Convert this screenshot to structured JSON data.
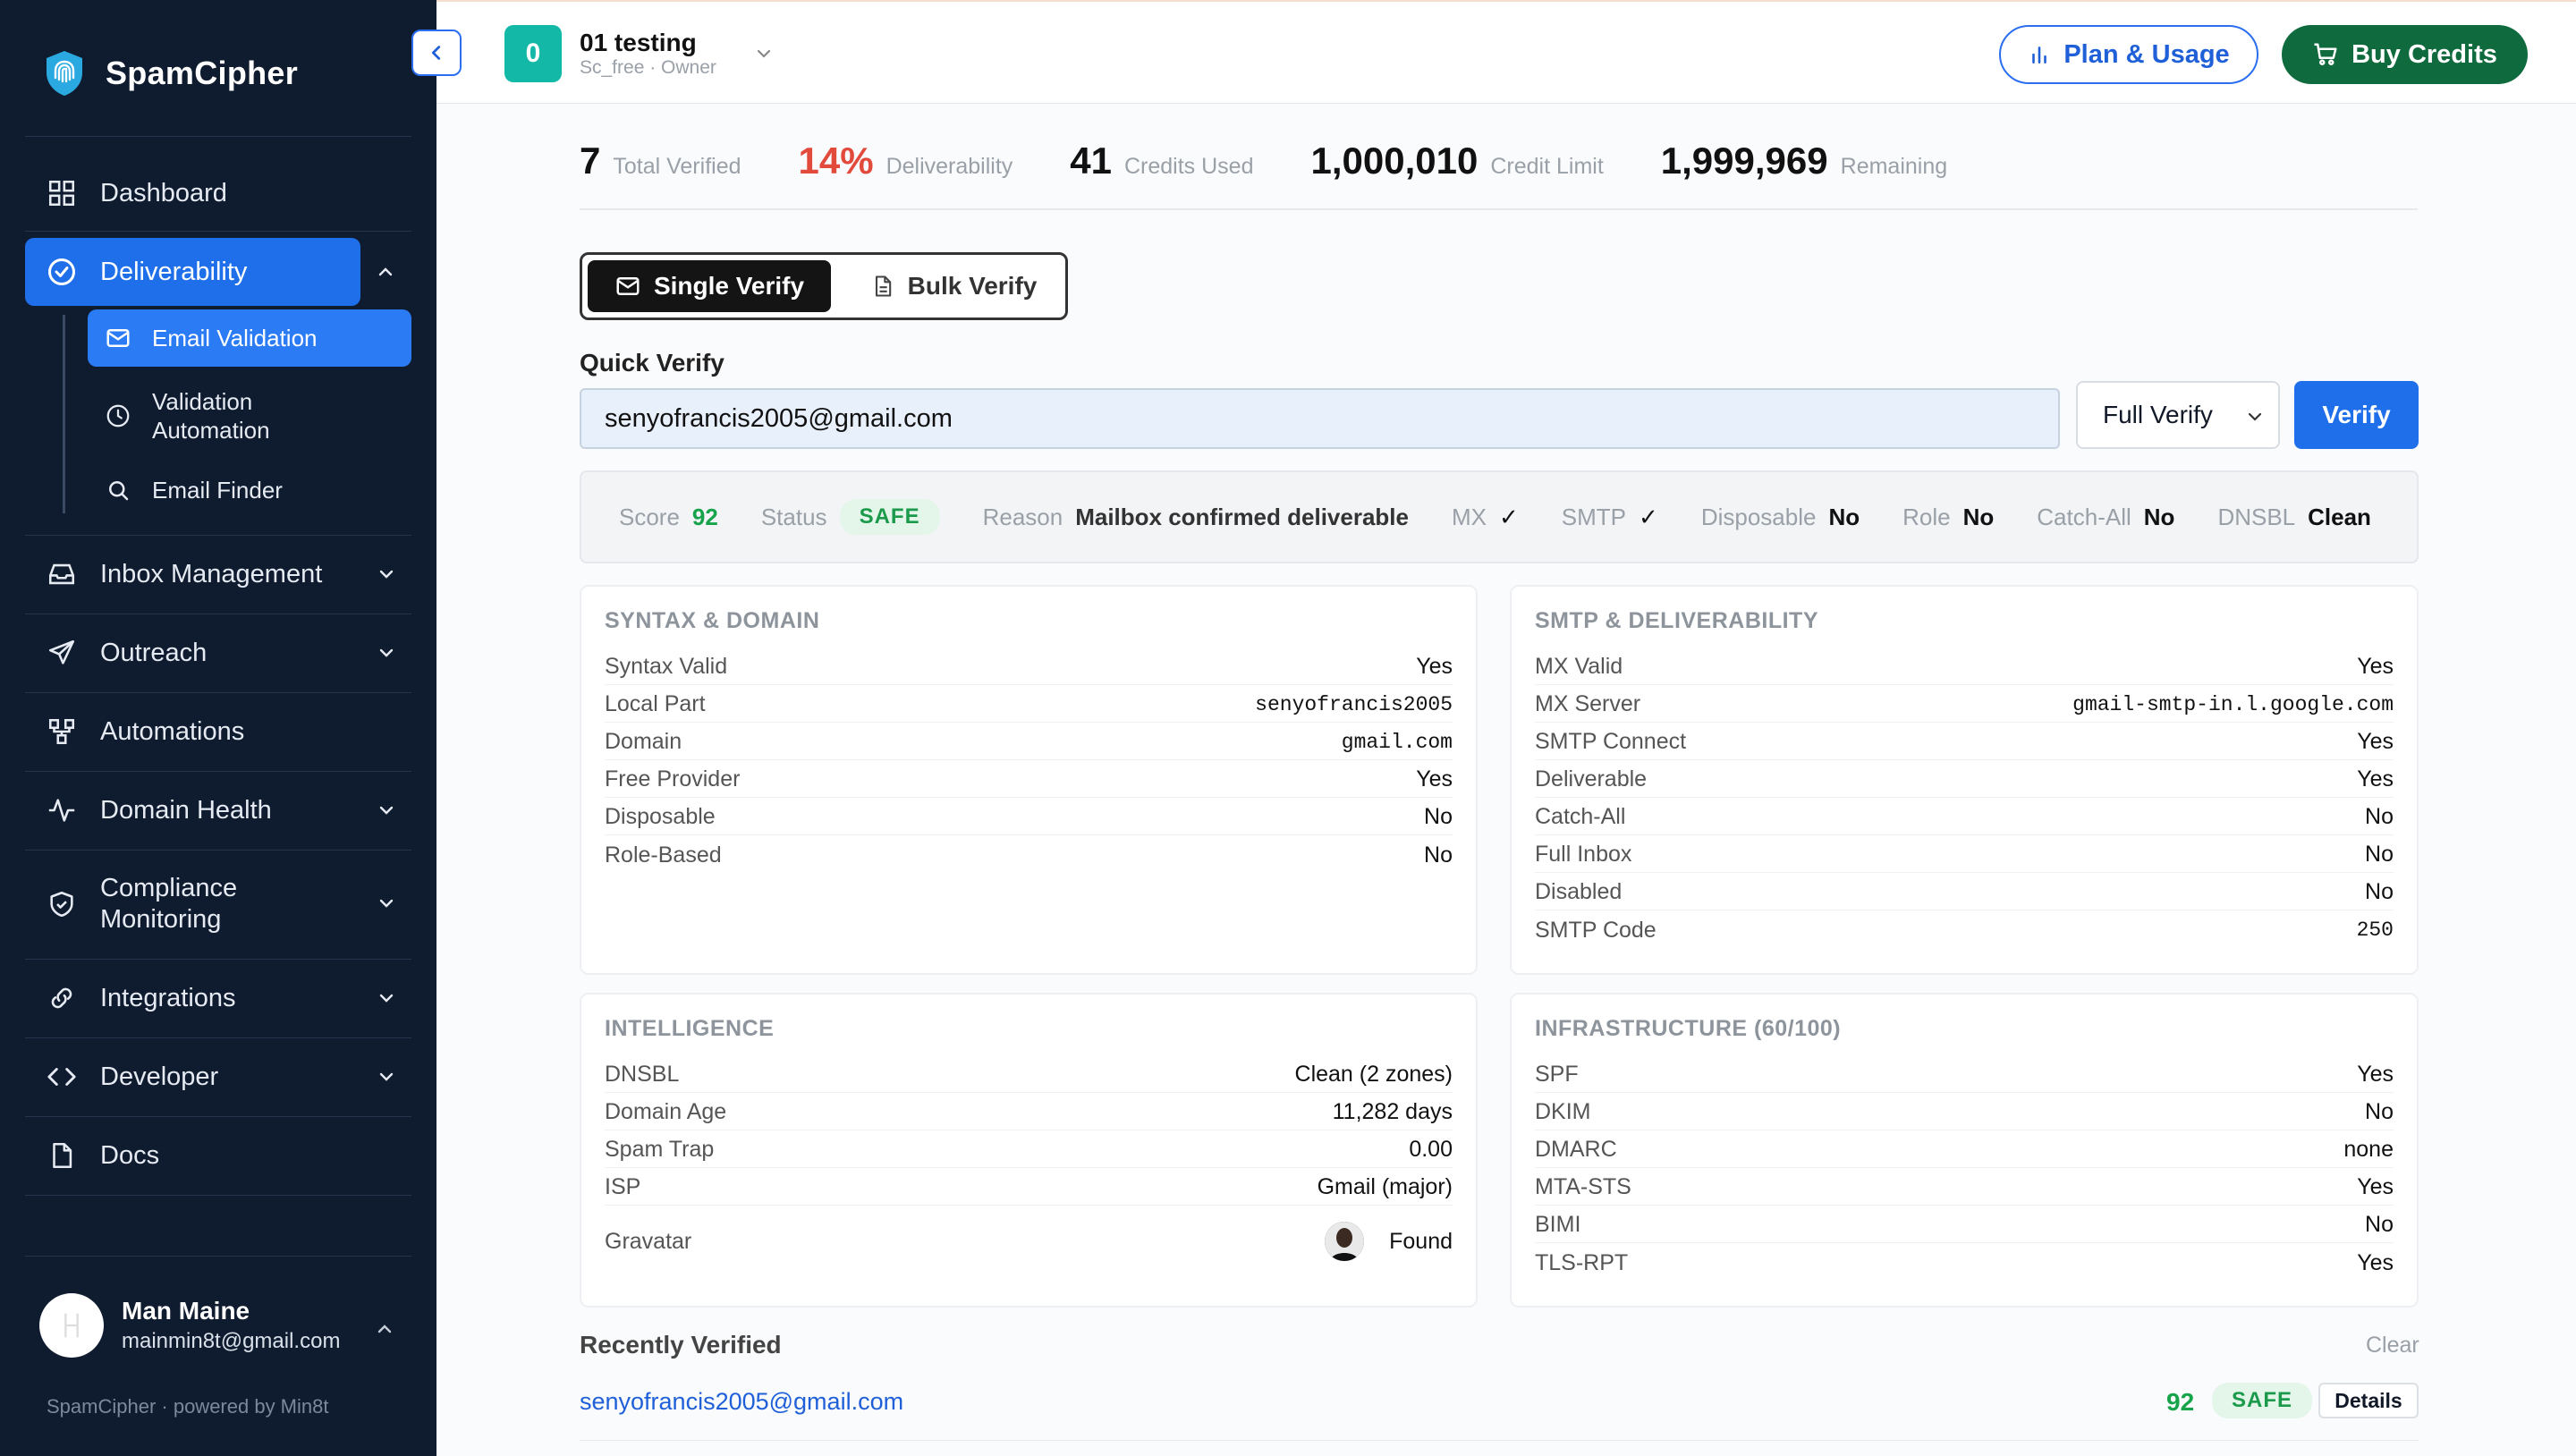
{
  "brand": {
    "name": "SpamCipher"
  },
  "sidebar": {
    "items": [
      {
        "label": "Dashboard"
      },
      {
        "label": "Deliverability"
      },
      {
        "label": "Inbox Management"
      },
      {
        "label": "Outreach"
      },
      {
        "label": "Automations"
      },
      {
        "label": "Domain Health"
      },
      {
        "label": "Compliance Monitoring"
      },
      {
        "label": "Integrations"
      },
      {
        "label": "Developer"
      },
      {
        "label": "Docs"
      }
    ],
    "sub_items": [
      {
        "label": "Email Validation"
      },
      {
        "label": "Validation Automation"
      },
      {
        "label": "Email Finder"
      }
    ],
    "user": {
      "name": "Man Maine",
      "email": "mainmin8t@gmail.com"
    },
    "footer": "SpamCipher · powered by Min8t"
  },
  "workspace": {
    "badge": "0",
    "name": "01 testing",
    "sub": "Sc_free · Owner"
  },
  "topbar": {
    "plan_label": "Plan & Usage",
    "buy_label": "Buy Credits"
  },
  "stats": [
    {
      "value": "7",
      "label": "Total Verified"
    },
    {
      "value": "14%",
      "label": "Deliverability"
    },
    {
      "value": "41",
      "label": "Credits Used"
    },
    {
      "value": "1,000,010",
      "label": "Credit Limit"
    },
    {
      "value": "1,999,969",
      "label": "Remaining"
    }
  ],
  "tabs": {
    "single": "Single Verify",
    "bulk": "Bulk Verify"
  },
  "quick_verify": {
    "label": "Quick Verify",
    "email": "senyofrancis2005@gmail.com",
    "mode": "Full Verify",
    "button": "Verify"
  },
  "result": {
    "score_label": "Score",
    "score": "92",
    "status_label": "Status",
    "status": "SAFE",
    "reason_label": "Reason",
    "reason": "Mailbox confirmed deliverable",
    "mx_label": "MX",
    "mx": "✓",
    "smtp_label": "SMTP",
    "smtp": "✓",
    "disposable_label": "Disposable",
    "disposable": "No",
    "role_label": "Role",
    "role": "No",
    "catchall_label": "Catch-All",
    "catchall": "No",
    "dnsbl_label": "DNSBL",
    "dnsbl": "Clean"
  },
  "cards": {
    "syntax": {
      "title": "SYNTAX & DOMAIN",
      "rows": [
        {
          "k": "Syntax Valid",
          "v": "Yes"
        },
        {
          "k": "Local Part",
          "v": "senyofrancis2005"
        },
        {
          "k": "Domain",
          "v": "gmail.com"
        },
        {
          "k": "Free Provider",
          "v": "Yes"
        },
        {
          "k": "Disposable",
          "v": "No"
        },
        {
          "k": "Role-Based",
          "v": "No"
        }
      ]
    },
    "smtp": {
      "title": "SMTP & DELIVERABILITY",
      "rows": [
        {
          "k": "MX Valid",
          "v": "Yes"
        },
        {
          "k": "MX Server",
          "v": "gmail-smtp-in.l.google.com"
        },
        {
          "k": "SMTP Connect",
          "v": "Yes"
        },
        {
          "k": "Deliverable",
          "v": "Yes"
        },
        {
          "k": "Catch-All",
          "v": "No"
        },
        {
          "k": "Full Inbox",
          "v": "No"
        },
        {
          "k": "Disabled",
          "v": "No"
        },
        {
          "k": "SMTP Code",
          "v": "250"
        }
      ]
    },
    "intel": {
      "title": "INTELLIGENCE",
      "rows": [
        {
          "k": "DNSBL",
          "v": "Clean (2 zones)"
        },
        {
          "k": "Domain Age",
          "v": "11,282 days"
        },
        {
          "k": "Spam Trap",
          "v": "0.00"
        },
        {
          "k": "ISP",
          "v": "Gmail (major)"
        },
        {
          "k": "Gravatar",
          "v": "Found"
        }
      ]
    },
    "infra": {
      "title": "INFRASTRUCTURE (60/100)",
      "rows": [
        {
          "k": "SPF",
          "v": "Yes"
        },
        {
          "k": "DKIM",
          "v": "No"
        },
        {
          "k": "DMARC",
          "v": "none"
        },
        {
          "k": "MTA-STS",
          "v": "Yes"
        },
        {
          "k": "BIMI",
          "v": "No"
        },
        {
          "k": "TLS-RPT",
          "v": "Yes"
        }
      ]
    }
  },
  "recent": {
    "title": "Recently Verified",
    "clear": "Clear",
    "items": [
      {
        "email": "senyofrancis2005@gmail.com",
        "score": "92",
        "status": "SAFE",
        "details": "Details"
      }
    ]
  }
}
